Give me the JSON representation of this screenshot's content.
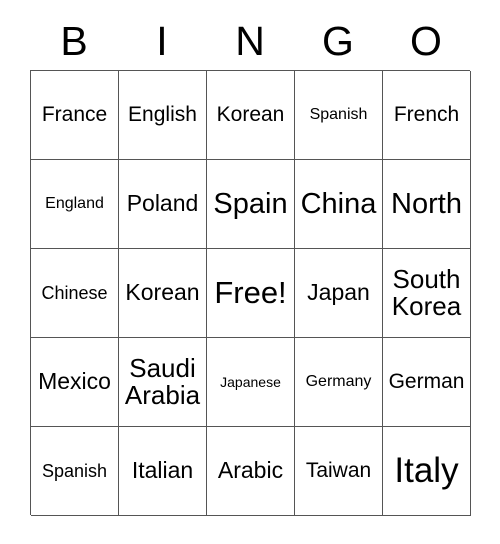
{
  "card": {
    "header_letters": [
      "B",
      "I",
      "N",
      "G",
      "O"
    ],
    "grid": {
      "rows": 5,
      "columns": 5,
      "border_color": "#555555",
      "cell_background": "#ffffff",
      "text_color": "#000000"
    },
    "cells": [
      [
        {
          "text": "France",
          "size": "m"
        },
        {
          "text": "English",
          "size": "m"
        },
        {
          "text": "Korean",
          "size": "m"
        },
        {
          "text": "Spanish",
          "size": "s"
        },
        {
          "text": "French",
          "size": "m"
        }
      ],
      [
        {
          "text": "England",
          "size": "s"
        },
        {
          "text": "Poland",
          "size": "ml"
        },
        {
          "text": "Spain",
          "size": "xl"
        },
        {
          "text": "China",
          "size": "xl"
        },
        {
          "text": "North",
          "size": "xl"
        }
      ],
      [
        {
          "text": "Chinese",
          "size": "sm"
        },
        {
          "text": "Korean",
          "size": "ml"
        },
        {
          "text": "Free!",
          "size": "xxl"
        },
        {
          "text": "Japan",
          "size": "ml"
        },
        {
          "text": "South\nKorea",
          "size": "l"
        }
      ],
      [
        {
          "text": "Mexico",
          "size": "ml"
        },
        {
          "text": "Saudi\nArabia",
          "size": "l"
        },
        {
          "text": "Japanese",
          "size": "xs"
        },
        {
          "text": "Germany",
          "size": "s"
        },
        {
          "text": "German",
          "size": "m"
        }
      ],
      [
        {
          "text": "Spanish",
          "size": "sm"
        },
        {
          "text": "Italian",
          "size": "ml"
        },
        {
          "text": "Arabic",
          "size": "ml"
        },
        {
          "text": "Taiwan",
          "size": "m"
        },
        {
          "text": "Italy",
          "size": "huge"
        }
      ]
    ]
  }
}
